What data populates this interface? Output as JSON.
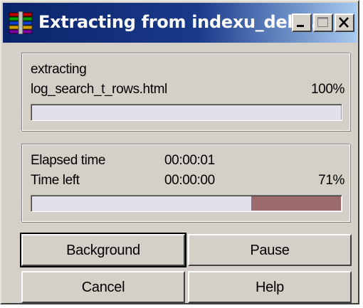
{
  "window": {
    "title": "Extracting from indexu_delu...",
    "icon": "archive-books-icon",
    "controls": {
      "minimize": "minimize-icon",
      "maximize": "maximize-icon",
      "close": "close-icon"
    }
  },
  "file_progress": {
    "status": "extracting",
    "filename": "log_search_t_rows.html",
    "percent_label": "100%",
    "percent": 100
  },
  "total_progress": {
    "elapsed_label": "Elapsed time",
    "elapsed_value": "00:00:01",
    "time_left_label": "Time left",
    "time_left_value": "00:00:00",
    "percent_label": "71%",
    "percent": 71
  },
  "buttons": {
    "background": "Background",
    "pause": "Pause",
    "cancel": "Cancel",
    "help": "Help"
  },
  "colors": {
    "title_bar": "#0a246a",
    "window_face": "#d4d0c8",
    "progress_remaining": "#9b6a6c"
  }
}
